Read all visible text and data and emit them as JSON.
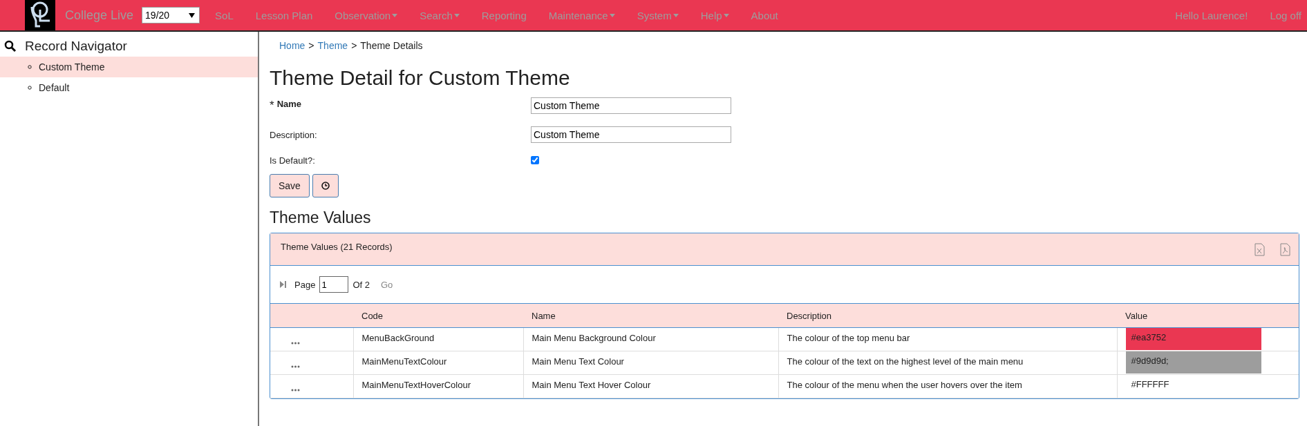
{
  "top_bar": {
    "app_name": "College Live",
    "year_select": "19/20",
    "menu": [
      {
        "label": "SoL",
        "dropdown": false
      },
      {
        "label": "Lesson Plan",
        "dropdown": false
      },
      {
        "label": "Observation",
        "dropdown": true
      },
      {
        "label": "Search",
        "dropdown": true
      },
      {
        "label": "Reporting",
        "dropdown": false
      },
      {
        "label": "Maintenance",
        "dropdown": true
      },
      {
        "label": "System",
        "dropdown": true
      },
      {
        "label": "Help",
        "dropdown": true
      },
      {
        "label": "About",
        "dropdown": false
      }
    ],
    "greeting": "Hello Laurence!",
    "logoff": "Log off"
  },
  "sidebar": {
    "title": "Record Navigator",
    "items": [
      {
        "label": "Custom Theme",
        "selected": true
      },
      {
        "label": "Default",
        "selected": false
      }
    ]
  },
  "breadcrumb_separator": ">",
  "breadcrumb": [
    {
      "label": "Home",
      "link": true
    },
    {
      "label": "Theme",
      "link": true
    },
    {
      "label": "Theme Details",
      "link": false
    }
  ],
  "heading": "Theme Detail for Custom Theme",
  "form": {
    "name_label": "Name",
    "required_mark": "*",
    "name_value": "Custom Theme",
    "description_label": "Description:",
    "description_value": "Custom Theme",
    "default_label": "Is Default?:",
    "is_default": true,
    "save_button": "Save"
  },
  "values_heading": "Theme Values",
  "panel": {
    "title": "Theme Values (21 Records)",
    "pager": {
      "page_label": "Page",
      "page": "1",
      "of": "Of 2",
      "go": "Go"
    },
    "columns": [
      "Code",
      "Name",
      "Description",
      "Value"
    ],
    "rows": [
      {
        "code": "MenuBackGround",
        "name": "Main Menu Background Colour",
        "description": "The colour of the top menu bar",
        "value": "#ea3752",
        "color": "#ea3752"
      },
      {
        "code": "MainMenuTextColour",
        "name": "Main Menu Text Colour",
        "description": "The colour of the text on the highest level of the main menu",
        "value": "#9d9d9d;",
        "color": "#9d9d9d"
      },
      {
        "code": "MainMenuTextHoverColour",
        "name": "Main Menu Text Hover Colour",
        "description": "The colour of the menu when the user hovers over the item",
        "value": "#FFFFFF",
        "color": "#ffffff"
      }
    ]
  }
}
